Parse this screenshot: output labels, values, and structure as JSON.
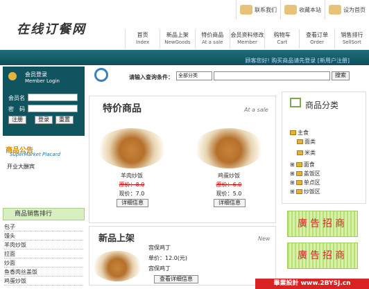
{
  "header": {
    "logo_text": "在线订餐网",
    "top_links": [
      {
        "label": "联系我们",
        "icon": "phone-icon"
      },
      {
        "label": "收藏本站",
        "icon": "favorite-icon"
      },
      {
        "label": "设为首页",
        "icon": "home-icon"
      }
    ],
    "nav": [
      {
        "label": "首页",
        "en": "Index"
      },
      {
        "label": "新品上架",
        "en": "NewGoods"
      },
      {
        "label": "特价商品",
        "en": "At a sale"
      },
      {
        "label": "会员资料修改",
        "en": "Member"
      },
      {
        "label": "购物车",
        "en": "Cart"
      },
      {
        "label": "查看订单",
        "en": "Order"
      },
      {
        "label": "销售排行",
        "en": "SellSort"
      }
    ],
    "welcome_text": "顾客您好! 购买商品请先登录 [新用户注册]"
  },
  "login": {
    "title": "会员登录",
    "subtitle": "Member Login",
    "username_label": "会员名",
    "password_label": "密　码",
    "register_label": "注册",
    "login_label": "登录",
    "reset_label": "重置"
  },
  "notice": {
    "title": "商品公告",
    "subtitle": "SuperMarket Placard",
    "items": [
      "开业大酬宾"
    ]
  },
  "rank": {
    "title": "商品销售排行",
    "items": [
      "包子",
      "馒头",
      "羊肉炒饭",
      "拉面",
      "炒面",
      "鱼香肉丝盖饭",
      "鸡蛋炒饭"
    ]
  },
  "search": {
    "label": "请输入查询条件：",
    "select_value": "全部分类",
    "button": "搜索"
  },
  "specials": {
    "title": "特价商品",
    "subtitle": "At a sale",
    "items": [
      {
        "name": "羊肉炒饭",
        "old_price": "原价：8.0",
        "new_price": "现价：7.0",
        "detail": "详细信息"
      },
      {
        "name": "鸡蛋炒饭",
        "old_price": "原价：6.0",
        "new_price": "现价：5.0",
        "detail": "详细信息"
      }
    ]
  },
  "new_goods": {
    "title": "新品上架",
    "subtitle": "New",
    "item": {
      "name": "宫保鸡丁",
      "price": "单价：12.0(元)",
      "name2": "宫保鸡丁",
      "detail": "查看详细信息"
    }
  },
  "categories": {
    "title": "商品分类",
    "items": [
      {
        "label": "主食",
        "level": 0
      },
      {
        "label": "面类",
        "level": 1
      },
      {
        "label": "米类",
        "level": 1
      },
      {
        "label": "面食",
        "level": 0
      },
      {
        "label": "盖饭区",
        "level": 0
      },
      {
        "label": "单点区",
        "level": 0
      },
      {
        "label": "炒饭区",
        "level": 0
      }
    ]
  },
  "ads": [
    "廣告招商",
    "廣告招商"
  ],
  "watermark": "畢業設計 www.2BYSJ.cn"
}
